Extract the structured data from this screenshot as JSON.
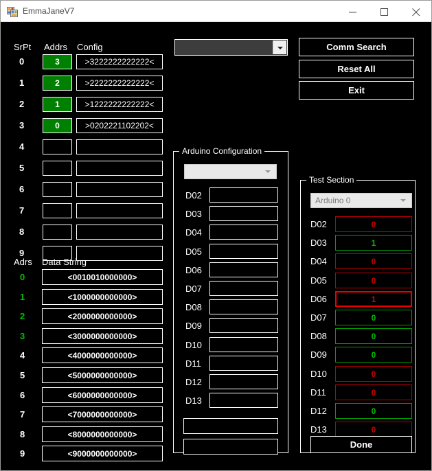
{
  "window": {
    "title": "EmmaJaneV7",
    "icon": "app-form-icon",
    "minimize_label": "minimize-icon",
    "maximize_label": "maximize-icon",
    "close_label": "close-icon"
  },
  "colors": {
    "background": "#000000",
    "foreground": "#ffffff",
    "green": "#00c000",
    "green_fill": "#008000",
    "red": "#cc0000",
    "combo_dark": "#3d3d3d"
  },
  "serial_table": {
    "headers": [
      "SrPt",
      "Addrs",
      "Config"
    ],
    "rows": [
      {
        "srpt": "0",
        "addrs": "3",
        "addrs_filled": true,
        "config": ">3222222222222<"
      },
      {
        "srpt": "1",
        "addrs": "2",
        "addrs_filled": true,
        "config": ">2222222222222<"
      },
      {
        "srpt": "2",
        "addrs": "1",
        "addrs_filled": true,
        "config": ">1222222222222<"
      },
      {
        "srpt": "3",
        "addrs": "0",
        "addrs_filled": true,
        "config": ">0202221102202<"
      },
      {
        "srpt": "4",
        "addrs": "",
        "addrs_filled": false,
        "config": ""
      },
      {
        "srpt": "5",
        "addrs": "",
        "addrs_filled": false,
        "config": ""
      },
      {
        "srpt": "6",
        "addrs": "",
        "addrs_filled": false,
        "config": ""
      },
      {
        "srpt": "7",
        "addrs": "",
        "addrs_filled": false,
        "config": ""
      },
      {
        "srpt": "8",
        "addrs": "",
        "addrs_filled": false,
        "config": ""
      },
      {
        "srpt": "9",
        "addrs": "",
        "addrs_filled": false,
        "config": ""
      }
    ]
  },
  "data_table": {
    "headers": [
      "Adrs",
      "Data String"
    ],
    "rows": [
      {
        "adrs": "0",
        "adrs_green": true,
        "data": "<0010010000000>"
      },
      {
        "adrs": "1",
        "adrs_green": true,
        "data": "<1000000000000>"
      },
      {
        "adrs": "2",
        "adrs_green": true,
        "data": "<2000000000000>"
      },
      {
        "adrs": "3",
        "adrs_green": true,
        "data": "<3000000000000>"
      },
      {
        "adrs": "4",
        "adrs_green": false,
        "data": "<4000000000000>"
      },
      {
        "adrs": "5",
        "adrs_green": false,
        "data": "<5000000000000>"
      },
      {
        "adrs": "6",
        "adrs_green": false,
        "data": "<6000000000000>"
      },
      {
        "adrs": "7",
        "adrs_green": false,
        "data": "<7000000000000>"
      },
      {
        "adrs": "8",
        "adrs_green": false,
        "data": "<8000000000000>"
      },
      {
        "adrs": "9",
        "adrs_green": false,
        "data": "<9000000000000>"
      }
    ]
  },
  "port_combo": {
    "value": "",
    "arrow_icon": "chevron-down-icon"
  },
  "buttons": {
    "comm_search": "Comm Search",
    "reset_all": "Reset All",
    "exit": "Exit"
  },
  "arduino_config": {
    "title": "Arduino Configuration",
    "combo_value": "",
    "combo_arrow_icon": "chevron-down-icon",
    "pins": [
      {
        "label": "D02",
        "value": ""
      },
      {
        "label": "D03",
        "value": ""
      },
      {
        "label": "D04",
        "value": ""
      },
      {
        "label": "D05",
        "value": ""
      },
      {
        "label": "D06",
        "value": ""
      },
      {
        "label": "D07",
        "value": ""
      },
      {
        "label": "D08",
        "value": ""
      },
      {
        "label": "D09",
        "value": ""
      },
      {
        "label": "D10",
        "value": ""
      },
      {
        "label": "D11",
        "value": ""
      },
      {
        "label": "D12",
        "value": ""
      },
      {
        "label": "D13",
        "value": ""
      }
    ],
    "extra_fields": [
      {
        "value": ""
      },
      {
        "value": ""
      }
    ]
  },
  "test_section": {
    "title": "Test Section",
    "combo_value": "Arduino 0",
    "combo_arrow_icon": "chevron-down-icon",
    "pins": [
      {
        "label": "D02",
        "value": "0",
        "state": "red"
      },
      {
        "label": "D03",
        "value": "1",
        "state": "green"
      },
      {
        "label": "D04",
        "value": "0",
        "state": "red"
      },
      {
        "label": "D05",
        "value": "0",
        "state": "red"
      },
      {
        "label": "D06",
        "value": "1",
        "state": "red-hot"
      },
      {
        "label": "D07",
        "value": "0",
        "state": "green"
      },
      {
        "label": "D08",
        "value": "0",
        "state": "green"
      },
      {
        "label": "D09",
        "value": "0",
        "state": "green"
      },
      {
        "label": "D10",
        "value": "0",
        "state": "red"
      },
      {
        "label": "D11",
        "value": "0",
        "state": "red"
      },
      {
        "label": "D12",
        "value": "0",
        "state": "green"
      },
      {
        "label": "D13",
        "value": "0",
        "state": "red"
      }
    ],
    "done_label": "Done"
  }
}
